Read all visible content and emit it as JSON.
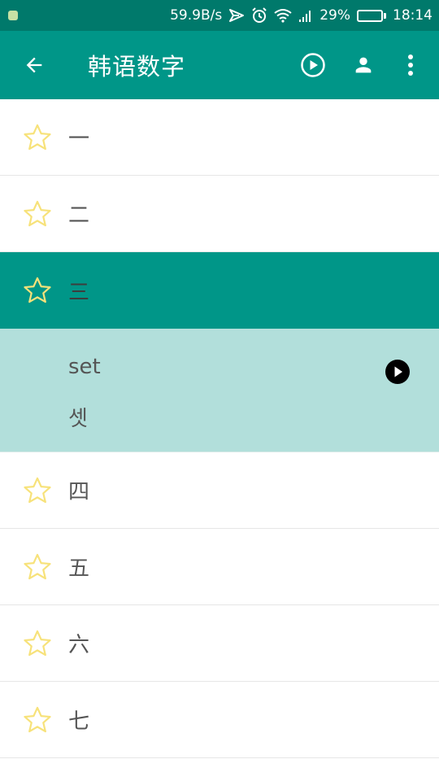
{
  "status_bar": {
    "network_speed": "59.9B/s",
    "battery_percent": "29%",
    "battery_level": 0.29,
    "time": "18:14"
  },
  "app_bar": {
    "title": "韩语数字"
  },
  "numbers": [
    {
      "label": "一"
    },
    {
      "label": "二"
    },
    {
      "label": "三"
    },
    {
      "label": "四"
    },
    {
      "label": "五"
    },
    {
      "label": "六"
    },
    {
      "label": "七"
    }
  ],
  "expanded": {
    "romanization": "set",
    "hangul": "셋"
  },
  "colors": {
    "status_bar": "#00796b",
    "app_bar": "#009688",
    "selected_row": "#009688",
    "detail_panel": "#b2dfdb",
    "star_outline": "#f7e27a"
  }
}
